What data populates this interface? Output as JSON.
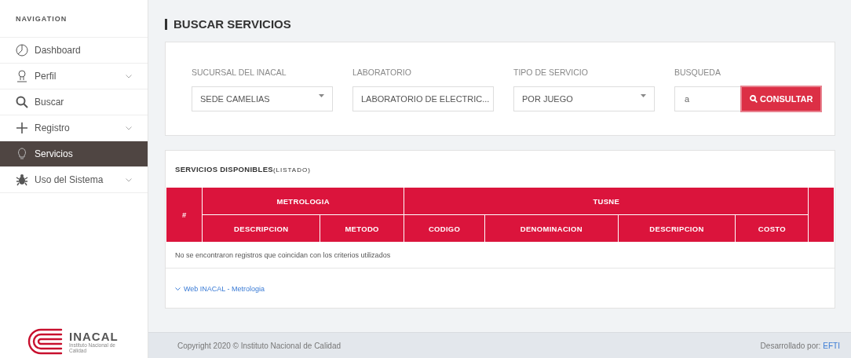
{
  "sidebar": {
    "heading": "NAVIGATION",
    "items": [
      {
        "label": "Dashboard",
        "expandable": false,
        "selected": false
      },
      {
        "label": "Perfil",
        "expandable": true,
        "selected": false
      },
      {
        "label": "Buscar",
        "expandable": false,
        "selected": false
      },
      {
        "label": "Registro",
        "expandable": true,
        "selected": false
      },
      {
        "label": "Servicios",
        "expandable": false,
        "selected": true
      },
      {
        "label": "Uso del Sistema",
        "expandable": true,
        "selected": false
      }
    ],
    "logo": {
      "name": "INACAL",
      "subtitle": "Instituto Nacional de Calidad"
    }
  },
  "page_title": "BUSCAR SERVICIOS",
  "filters": [
    {
      "kind": "select",
      "label": "SUCURSAL DEL INACAL",
      "value": "SEDE CAMELIAS"
    },
    {
      "kind": "select",
      "label": "LABORATORIO",
      "value": "LABORATORIO DE ELECTRIC..."
    },
    {
      "kind": "select",
      "label": "TIPO DE SERVICIO",
      "value": "POR JUEGO"
    },
    {
      "kind": "search",
      "label": "BUSQUEDA",
      "value": "a",
      "button": "CONSULTAR"
    }
  ],
  "results": {
    "title": "SERVICIOS DISPONIBLES",
    "subtitle": "(LISTADO)",
    "index_header": "#",
    "groups": [
      {
        "label": "METROLOGIA",
        "columns": [
          "DESCRIPCION",
          "METODO"
        ]
      },
      {
        "label": "TUSNE",
        "columns": [
          "CODIGO",
          "DENOMINACION",
          "DESCRIPCION",
          "COSTO"
        ]
      }
    ],
    "empty_message": "No se encontraron registros que coincidan con los criterios utilizados",
    "link": "Web INACAL - Metrologia"
  },
  "footer": {
    "copyright": "Copyright 2020 © Instituto Nacional de Calidad",
    "credit": "Desarrollado por:",
    "credit_link": "EFTI"
  }
}
